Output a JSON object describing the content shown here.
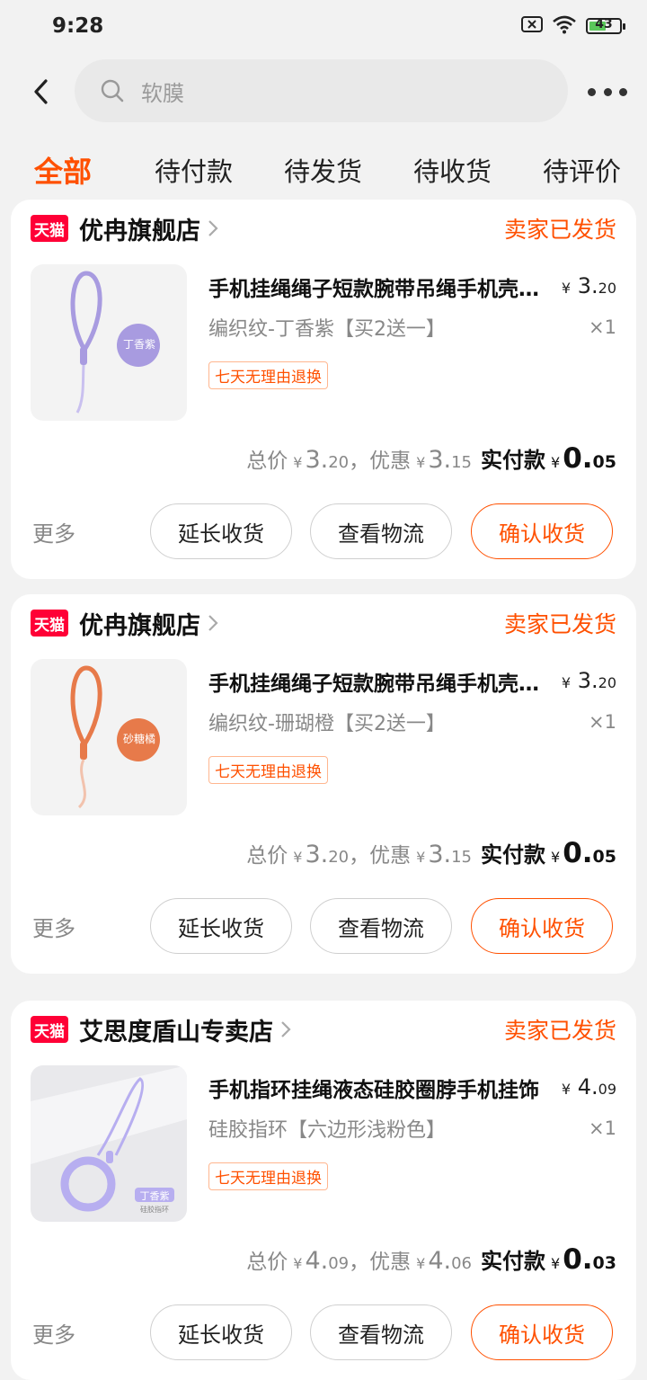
{
  "status_bar": {
    "time": "9:28",
    "battery": "43"
  },
  "search": {
    "placeholder": "软膜"
  },
  "tabs": [
    "全部",
    "待付款",
    "待发货",
    "待收货",
    "待评价"
  ],
  "tmall_badge": "天猫",
  "orders": [
    {
      "shop": "优冉旗舰店",
      "status": "卖家已发货",
      "title": "手机挂绳绳子短款腕带吊绳手机壳挂饰防丢",
      "spec": "编织纹-丁香紫【买2送一】",
      "price_int": "3.",
      "price_dec": "20",
      "qty": "×1",
      "tag": "七天无理由退换",
      "thumb_label": "丁香紫",
      "thumb_color": "#a89be0",
      "total_label": "总价",
      "total_int": "3.",
      "total_dec": "20",
      "discount_label": "，优惠",
      "discount_int": "3.",
      "discount_dec": "15",
      "paid_label": "实付款",
      "paid_int": "0.",
      "paid_dec": "05",
      "more": "更多",
      "btn_extend": "延长收货",
      "btn_logistics": "查看物流",
      "btn_confirm": "确认收货"
    },
    {
      "shop": "优冉旗舰店",
      "status": "卖家已发货",
      "title": "手机挂绳绳子短款腕带吊绳手机壳挂饰防丢",
      "spec": "编织纹-珊瑚橙【买2送一】",
      "price_int": "3.",
      "price_dec": "20",
      "qty": "×1",
      "tag": "七天无理由退换",
      "thumb_label": "砂糖橘",
      "thumb_color": "#e77a4a",
      "total_label": "总价",
      "total_int": "3.",
      "total_dec": "20",
      "discount_label": "，优惠",
      "discount_int": "3.",
      "discount_dec": "15",
      "paid_label": "实付款",
      "paid_int": "0.",
      "paid_dec": "05",
      "more": "更多",
      "btn_extend": "延长收货",
      "btn_logistics": "查看物流",
      "btn_confirm": "确认收货"
    },
    {
      "shop": "艾思度盾山专卖店",
      "status": "卖家已发货",
      "title": "手机指环挂绳液态硅胶圈脖手机挂饰",
      "spec": "硅胶指环【六边形浅粉色】",
      "price_int": "4.",
      "price_dec": "09",
      "qty": "×1",
      "tag": "七天无理由退换",
      "thumb_label": "丁香紫",
      "thumb_sub": "硅胶指环",
      "thumb_color": "#b7aef0",
      "total_label": "总价",
      "total_int": "4.",
      "total_dec": "09",
      "discount_label": "，优惠",
      "discount_int": "4.",
      "discount_dec": "06",
      "paid_label": "实付款",
      "paid_int": "0.",
      "paid_dec": "03",
      "more": "更多",
      "btn_extend": "延长收货",
      "btn_logistics": "查看物流",
      "btn_confirm": "确认收货"
    }
  ],
  "colors": {
    "accent": "#ff5000",
    "tmall": "#ff0036"
  }
}
